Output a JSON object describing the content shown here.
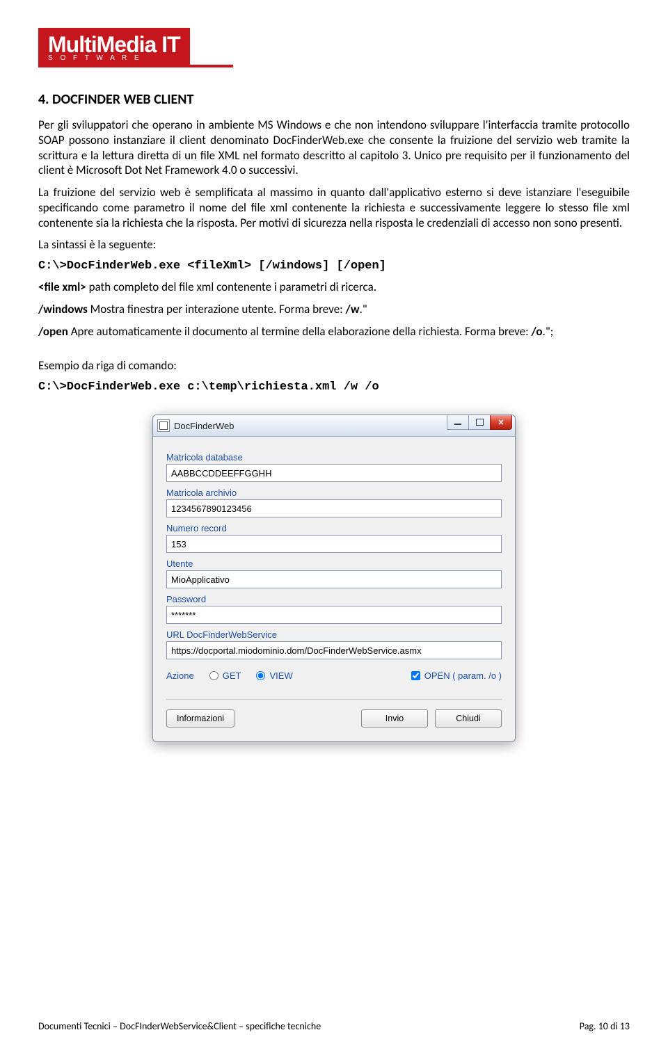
{
  "logo": {
    "main": "MultiMedia IT",
    "sub": "S     O     F     T     W     A     R     E"
  },
  "section_title": "4. DOCFINDER WEB CLIENT",
  "para1": "Per gli sviluppatori che operano in ambiente MS Windows e che non intendono sviluppare l'interfaccia tramite protocollo SOAP possono instanziare il client denominato DocFinderWeb.exe che consente la fruizione del servizio web  tramite la scrittura e la lettura diretta di un file XML nel formato descritto al capitolo 3. Unico pre requisito per il funzionamento del client è Microsoft Dot Net Framework 4.0 o successivi.",
  "para2": "La fruizione del servizio web è semplificata al massimo in quanto dall'applicativo esterno si deve istanziare l'eseguibile specificando come parametro il nome del file xml contenente la richiesta e successivamente leggere lo stesso file xml contenente sia la richiesta che la risposta. Per motivi di sicurezza nella risposta le credenziali di accesso non sono presenti.",
  "syntax_intro": "La sintassi è la seguente:",
  "syntax_cmd": "C:\\>DocFinderWeb.exe <fileXml> [/windows] [/open]",
  "opt_filexml_label": "<file xml>",
  "opt_filexml_desc": " path completo del file xml contenente i parametri di ricerca.",
  "opt_windows_label": "/windows",
  "opt_windows_desc": "  Mostra finestra per interazione utente. Forma breve: ",
  "opt_windows_short": "/w",
  "opt_windows_tail": ".\"",
  "opt_open_label": "/open",
  "opt_open_desc": " Apre automaticamente il documento al termine della elaborazione della richiesta. Forma breve: ",
  "opt_open_short": "/o",
  "opt_open_tail": ".\";",
  "example_intro": "Esempio da riga di comando:",
  "example_cmd": "C:\\>DocFinderWeb.exe c:\\temp\\richiesta.xml /w /o",
  "dialog": {
    "title": "DocFinderWeb",
    "fields": {
      "matricola_db": {
        "label": "Matricola database",
        "value": "AABBCCDDEEFFGGHH"
      },
      "matricola_arch": {
        "label": "Matricola archivio",
        "value": "1234567890123456"
      },
      "numero_record": {
        "label": "Numero record",
        "value": "153"
      },
      "utente": {
        "label": "Utente",
        "value": "MioApplicativo"
      },
      "password": {
        "label": "Password",
        "value": "*******"
      },
      "url": {
        "label": "URL DocFinderWebService",
        "value": "https://docportal.miodominio.dom/DocFinderWebService.asmx"
      }
    },
    "azione_label": "Azione",
    "radio_get": "GET",
    "radio_view": "VIEW",
    "check_open": "OPEN ( param. /o )",
    "btn_info": "Informazioni",
    "btn_invio": "Invio",
    "btn_chiudi": "Chiudi"
  },
  "footer_left": "Documenti Tecnici – DocFInderWebService&Client – specifiche tecniche",
  "footer_right": "Pag. 10 di 13"
}
